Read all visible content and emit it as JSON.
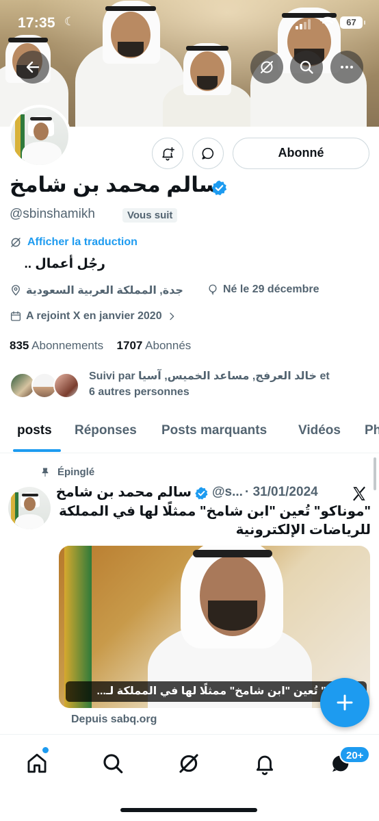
{
  "status_bar": {
    "time": "17:35",
    "battery": "67"
  },
  "profile": {
    "name": "سالم محمد بن شامخ",
    "handle": "@sbinshamikh",
    "follows_you": "Vous suit",
    "follow_state": "Abonné",
    "translate_label": "Afficher la traduction",
    "bio": "رجُل أعمال ..",
    "location": "جدة, المملكة العربية السعودية",
    "birthday": "Né le 29 décembre",
    "joined": "A rejoint X en janvier 2020",
    "following_count": "835",
    "following_label": "Abonnements",
    "followers_count": "1707",
    "followers_label": "Abonnés",
    "followed_by_line1": "Suivi par خالد العرفج, مساعد الخميس, آسيا et",
    "followed_by_line2": "6 autres personnes"
  },
  "tabs": [
    {
      "label": "posts",
      "active": true
    },
    {
      "label": "Réponses",
      "active": false
    },
    {
      "label": "Posts marquants",
      "active": false
    },
    {
      "label": "Vidéos",
      "active": false
    },
    {
      "label": "Ph",
      "active": false
    }
  ],
  "post": {
    "pinned_label": "Épinglé",
    "author_name": "سالم محمد بن شامخ",
    "author_handle_short": "@s...",
    "date": "· 31/01/2024",
    "text": "\"موناكو\" تُعين \"ابن شامخ\" ممثلًا لها في المملكة للرياضات الإلكترونية",
    "image_caption": "موناكو\" تُعين \"ابن شامخ\" ممثلًا لها في المملكة لـ...",
    "source": "Depuis sabq.org"
  },
  "bottom_nav": {
    "notifications_badge": "20+"
  },
  "colors": {
    "accent": "#1d9bf0",
    "text_primary": "#0f1419",
    "text_secondary": "#536471"
  },
  "icons": [
    "back-arrow-icon",
    "grok-icon",
    "search-icon",
    "more-icon",
    "bell-plus-icon",
    "message-icon",
    "verified-badge-icon",
    "translate-icon",
    "location-pin-icon",
    "birthday-icon",
    "calendar-icon",
    "pin-icon",
    "x-logo-icon",
    "plus-icon",
    "home-icon",
    "explore-icon",
    "grok-nav-icon",
    "notifications-icon",
    "messages-icon"
  ]
}
